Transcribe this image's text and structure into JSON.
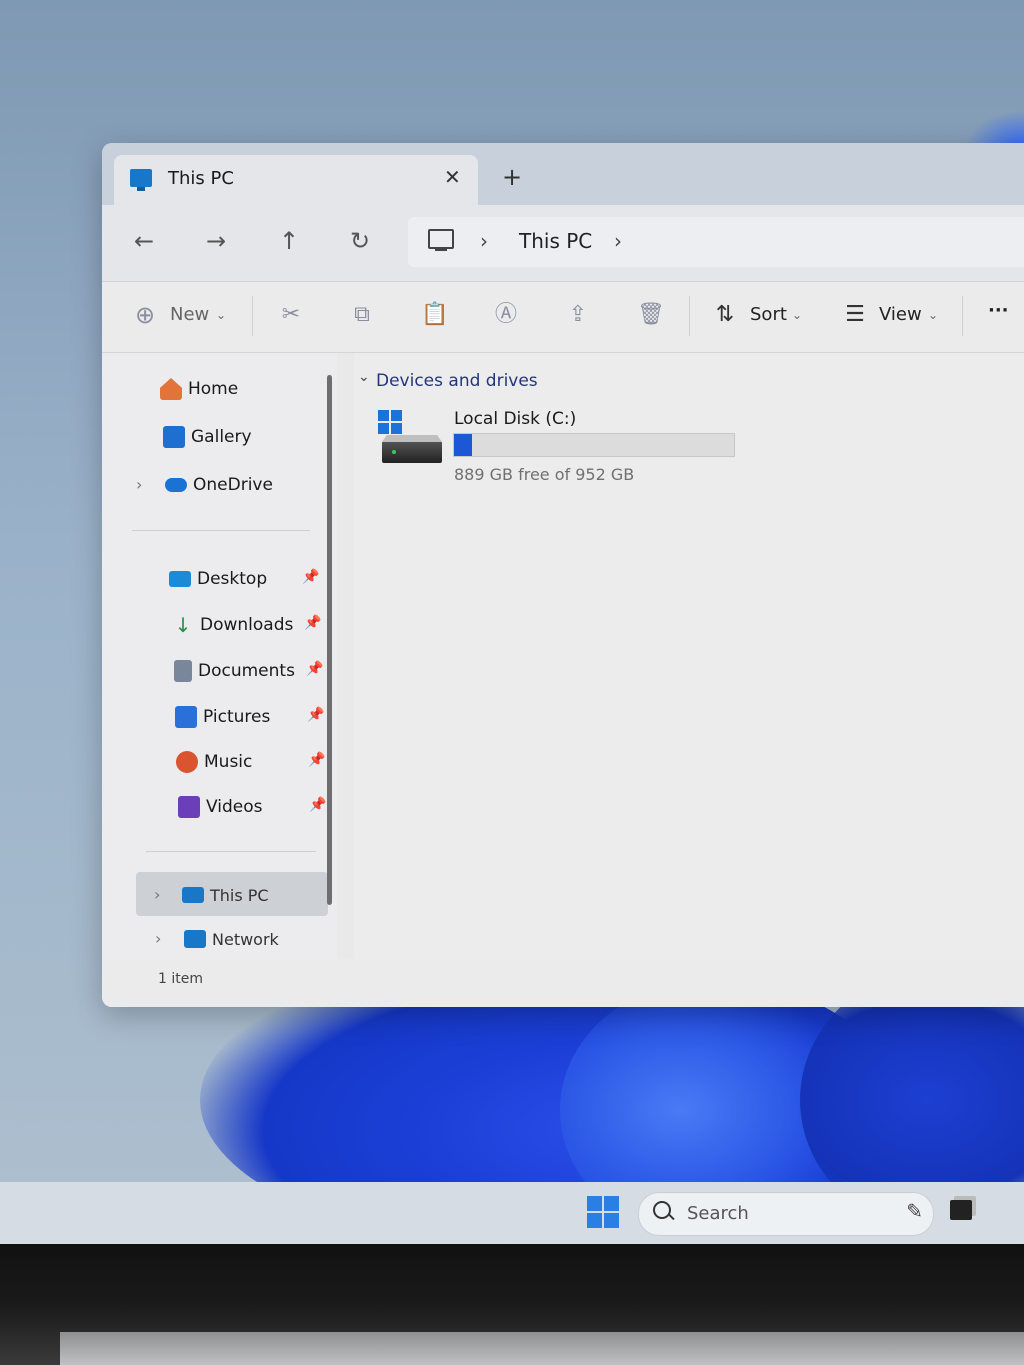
{
  "window": {
    "tab_title": "This PC",
    "tab_close": "✕",
    "tab_add": "+"
  },
  "nav": {
    "back": "←",
    "forward": "→",
    "up": "↑",
    "refresh": "↻",
    "breadcrumb_sep": "›",
    "breadcrumb": "This PC"
  },
  "toolbar": {
    "new_label": "New",
    "sort_label": "Sort",
    "view_label": "View",
    "dropdown": "⌄",
    "more": "···"
  },
  "sidebar": {
    "items": [
      {
        "label": "Home",
        "icon": "home-icon",
        "color": "#e2733a"
      },
      {
        "label": "Gallery",
        "icon": "gallery-icon",
        "color": "#1f6fd1"
      },
      {
        "label": "OneDrive",
        "icon": "onedrive-icon",
        "color": "#1a73d4"
      }
    ],
    "quick_access": [
      {
        "label": "Desktop",
        "icon": "desktop-icon",
        "color": "#1b8ad8"
      },
      {
        "label": "Downloads",
        "icon": "downloads-icon",
        "color": "#2c8a4a"
      },
      {
        "label": "Documents",
        "icon": "documents-icon",
        "color": "#7a869a"
      },
      {
        "label": "Pictures",
        "icon": "pictures-icon",
        "color": "#2b6fd8"
      },
      {
        "label": "Music",
        "icon": "music-icon",
        "color": "#d9542f"
      },
      {
        "label": "Videos",
        "icon": "videos-icon",
        "color": "#6b3fb8"
      }
    ],
    "locations": [
      {
        "label": "This PC",
        "icon": "this-pc-icon",
        "color": "#1877c9"
      },
      {
        "label": "Network",
        "icon": "network-icon",
        "color": "#1877c9"
      }
    ],
    "chevron": "›",
    "pin": "📌"
  },
  "content": {
    "group_label": "Devices and drives",
    "group_chevron": "⌄",
    "drive": {
      "name": "Local Disk (C:)",
      "free_text": "889 GB free of 952 GB",
      "used_fraction": 0.066
    }
  },
  "status": {
    "item_count": "1 item"
  },
  "taskbar": {
    "search_label": "Search"
  }
}
